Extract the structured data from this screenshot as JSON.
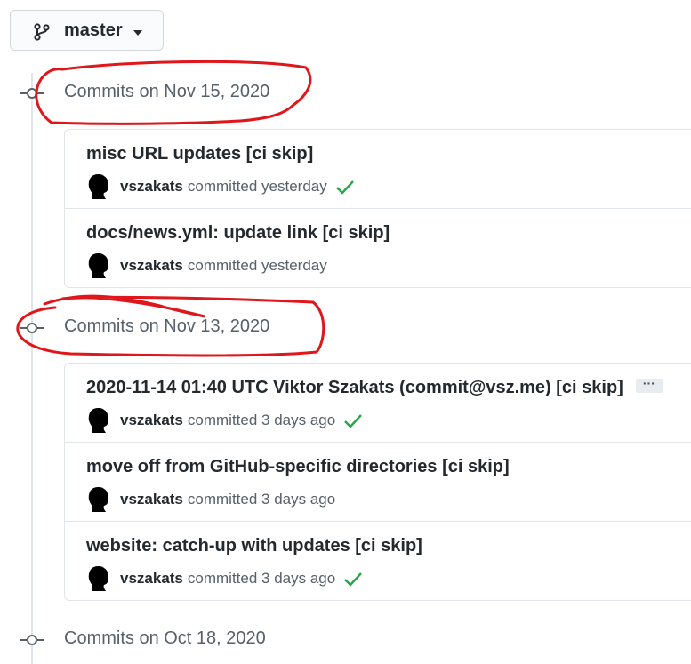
{
  "branch": {
    "name": "master",
    "icon": "git-branch-icon"
  },
  "groups": [
    {
      "date_label": "Commits on Nov 15, 2020",
      "commits": [
        {
          "title": "misc URL updates [ci skip]",
          "author": "vszakats",
          "meta": "committed yesterday",
          "status": "success"
        },
        {
          "title": "docs/news.yml: update link [ci skip]",
          "author": "vszakats",
          "meta": "committed yesterday",
          "status": "none"
        }
      ]
    },
    {
      "date_label": "Commits on Nov 13, 2020",
      "commits": [
        {
          "title": "2020-11-14 01:40 UTC Viktor Szakats (commit@vsz.me) [ci skip]",
          "author": "vszakats",
          "meta": "committed 3 days ago",
          "status": "success",
          "ellipsis": "···"
        },
        {
          "title": "move off from GitHub-specific directories [ci skip]",
          "author": "vszakats",
          "meta": "committed 3 days ago",
          "status": "none"
        },
        {
          "title": "website: catch-up with updates [ci skip]",
          "author": "vszakats",
          "meta": "committed 3 days ago",
          "status": "success"
        }
      ]
    },
    {
      "date_label": "Commits on Oct 18, 2020",
      "commits": []
    }
  ],
  "colors": {
    "annotation": "#e0161b",
    "success": "#28a745",
    "muted": "#586069",
    "border": "#e1e4e8"
  }
}
